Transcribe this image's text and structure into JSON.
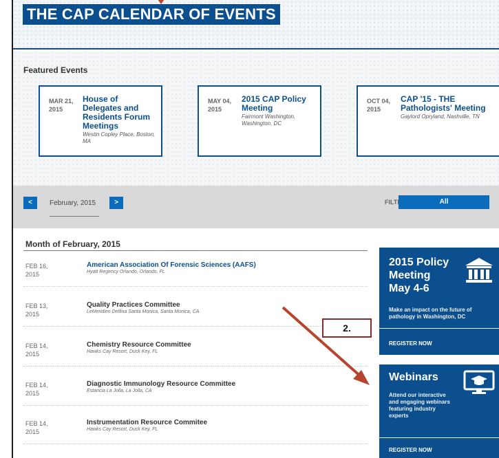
{
  "banner": {
    "title": "THE CAP CALENDAR OF EVENTS"
  },
  "featured": {
    "heading": "Featured Events",
    "events": [
      {
        "date_month": "MAR 21,",
        "date_year": "2015",
        "title": "House of Delegates and Residents Forum Meetings",
        "location": "Westin Copley Place, Boston, MA"
      },
      {
        "date_month": "MAY 04,",
        "date_year": "2015",
        "title": "2015 CAP Policy Meeting",
        "location": "Fairmont Washington, Washington, DC"
      },
      {
        "date_month": "OCT 04,",
        "date_year": "2015",
        "title": "CAP '15 - THE Pathologists' Meeting",
        "location": "Gaylord Opryland, Nashville, TN"
      }
    ]
  },
  "filter_bar": {
    "prev_label": "<",
    "next_label": ">",
    "current_month": "February, 2015",
    "filter_label": "FILTER BY",
    "filter_value": "All"
  },
  "month_list": {
    "heading": "Month of February, 2015",
    "events": [
      {
        "date_month": "FEB 16,",
        "date_year": "2015",
        "name": "American Association Of Forensic Sciences (AAFS)",
        "location": "Hyatt Regency Orlando, Orlando, FL"
      },
      {
        "date_month": "FEB 13,",
        "date_year": "2015",
        "name": "Quality Practices Committee",
        "location": "LeMeridien Delfina Santa Monica, Santa Monica, CA"
      },
      {
        "date_month": "FEB 14,",
        "date_year": "2015",
        "name": "Chemistry Resource Committee",
        "location": "Hawks Cay Resort, Duck Key, FL"
      },
      {
        "date_month": "FEB 14,",
        "date_year": "2015",
        "name": "Diagnostic Immunology Resource Committee",
        "location": "Estancia La Jolla, La Jolla, CA"
      },
      {
        "date_month": "FEB 14,",
        "date_year": "2015",
        "name": "Instrumentation Resource Commitee",
        "location": "Hawks Cay Resort, Duck Key, FL"
      }
    ]
  },
  "promos": {
    "policy": {
      "title_line1": "2015 Policy",
      "title_line2": "Meeting",
      "title_line3": "May 4-6",
      "desc_line1": "Make an impact on the future of",
      "desc_line2": "pathology in Washington, DC",
      "register": "REGISTER NOW",
      "icon": "capitol-building-icon"
    },
    "webinars": {
      "title": "Webinars",
      "desc_line1": "Attend our interactive",
      "desc_line2": "and engaging webinars",
      "desc_line3": "featuring industry",
      "desc_line4": "experts",
      "register": "REGISTER NOW",
      "icon": "monitor-graduation-cap-icon"
    }
  },
  "annotation": {
    "callout_label": "2."
  },
  "colors": {
    "brand_blue": "#0b4f8e",
    "button_blue": "#0b6bbd",
    "annotation_arrow": "#b5452e"
  }
}
